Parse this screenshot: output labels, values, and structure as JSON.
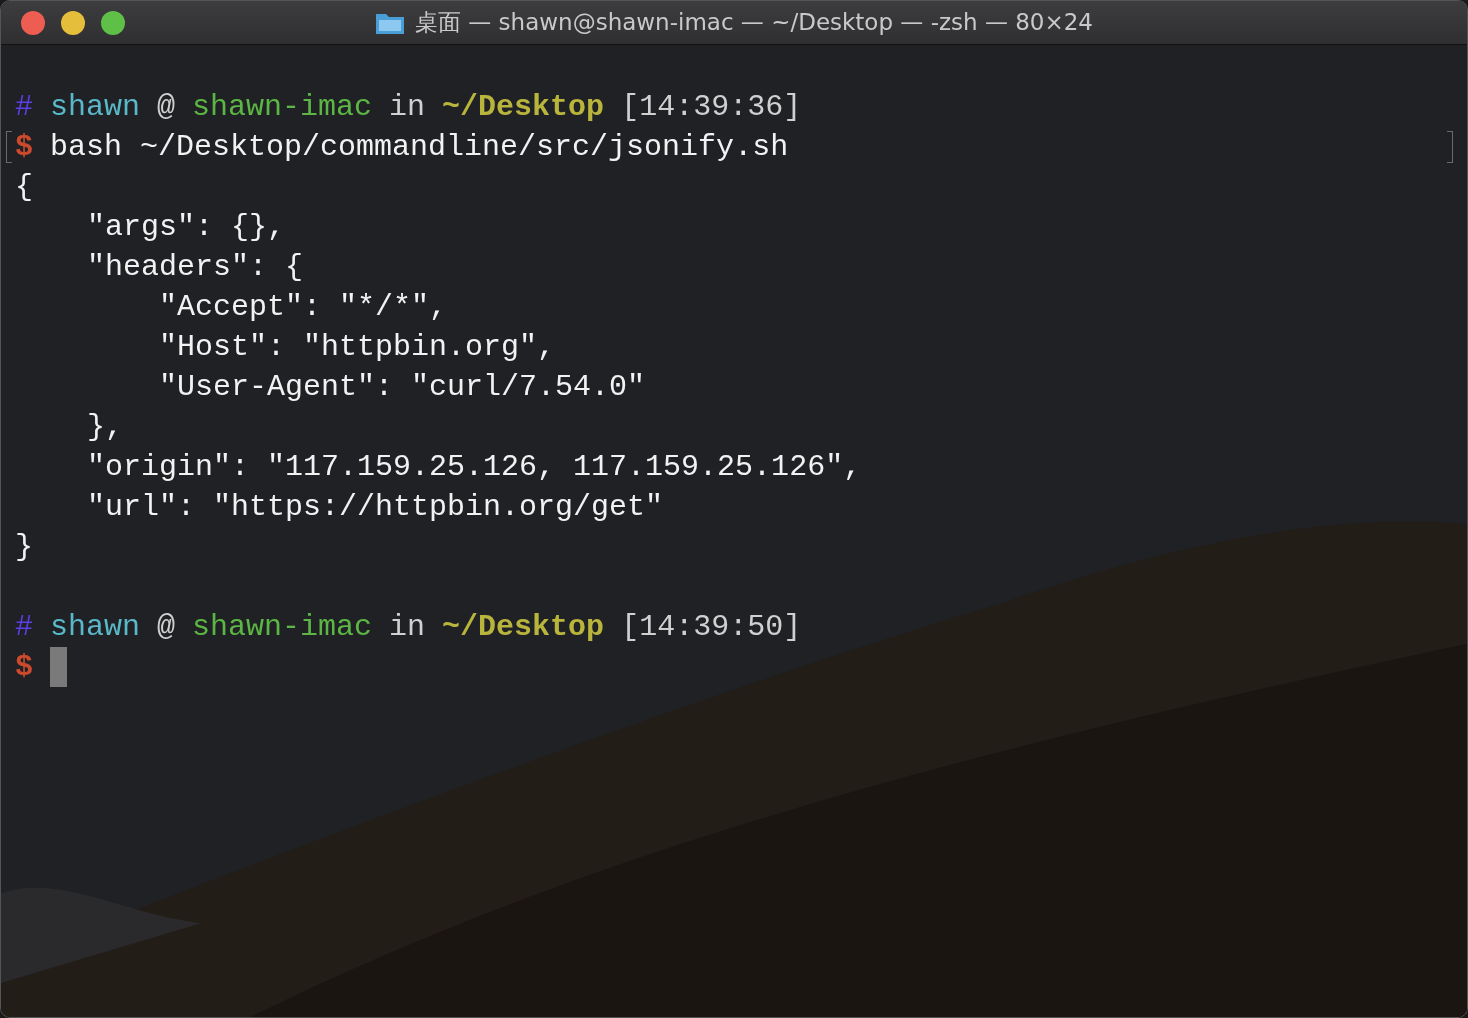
{
  "window": {
    "title": "桌面 — shawn@shawn-imac — ~/Desktop — -zsh — 80×24"
  },
  "terminal": {
    "lines": [
      {
        "kind": "prompt",
        "segments": [
          {
            "kind": "hash",
            "text": "#"
          },
          {
            "kind": "user",
            "text": "shawn"
          },
          {
            "kind": "plain",
            "text": "@"
          },
          {
            "kind": "host",
            "text": "shawn-imac"
          },
          {
            "kind": "plain",
            "text": "in"
          },
          {
            "kind": "dir",
            "text": "~/Desktop"
          },
          {
            "kind": "plain",
            "text": "[14:39:36]"
          }
        ]
      },
      {
        "kind": "command",
        "symbol": "$",
        "text": "bash ~/Desktop/commandline/src/jsonify.sh",
        "marked": true,
        "cursor": false
      },
      {
        "kind": "output",
        "text": "{"
      },
      {
        "kind": "output",
        "text": "    \"args\": {},"
      },
      {
        "kind": "output",
        "text": "    \"headers\": {"
      },
      {
        "kind": "output",
        "text": "        \"Accept\": \"*/*\","
      },
      {
        "kind": "output",
        "text": "        \"Host\": \"httpbin.org\","
      },
      {
        "kind": "output",
        "text": "        \"User-Agent\": \"curl/7.54.0\""
      },
      {
        "kind": "output",
        "text": "    },"
      },
      {
        "kind": "output",
        "text": "    \"origin\": \"117.159.25.126, 117.159.25.126\","
      },
      {
        "kind": "output",
        "text": "    \"url\": \"https://httpbin.org/get\""
      },
      {
        "kind": "output",
        "text": "}"
      },
      {
        "kind": "blank"
      },
      {
        "kind": "prompt",
        "segments": [
          {
            "kind": "hash",
            "text": "#"
          },
          {
            "kind": "user",
            "text": "shawn"
          },
          {
            "kind": "plain",
            "text": "@"
          },
          {
            "kind": "host",
            "text": "shawn-imac"
          },
          {
            "kind": "plain",
            "text": "in"
          },
          {
            "kind": "dir",
            "text": "~/Desktop"
          },
          {
            "kind": "plain",
            "text": "[14:39:50]"
          }
        ]
      },
      {
        "kind": "command",
        "symbol": "$",
        "marked": false,
        "cursor": true
      }
    ]
  }
}
